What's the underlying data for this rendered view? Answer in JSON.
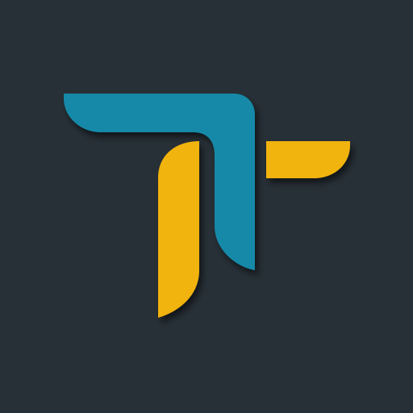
{
  "icon": {
    "name": "tt-logo-icon",
    "colors": {
      "background": "#273037",
      "blue": "#1589a8",
      "yellow": "#f1b308",
      "shadow": "#0e1418"
    }
  }
}
